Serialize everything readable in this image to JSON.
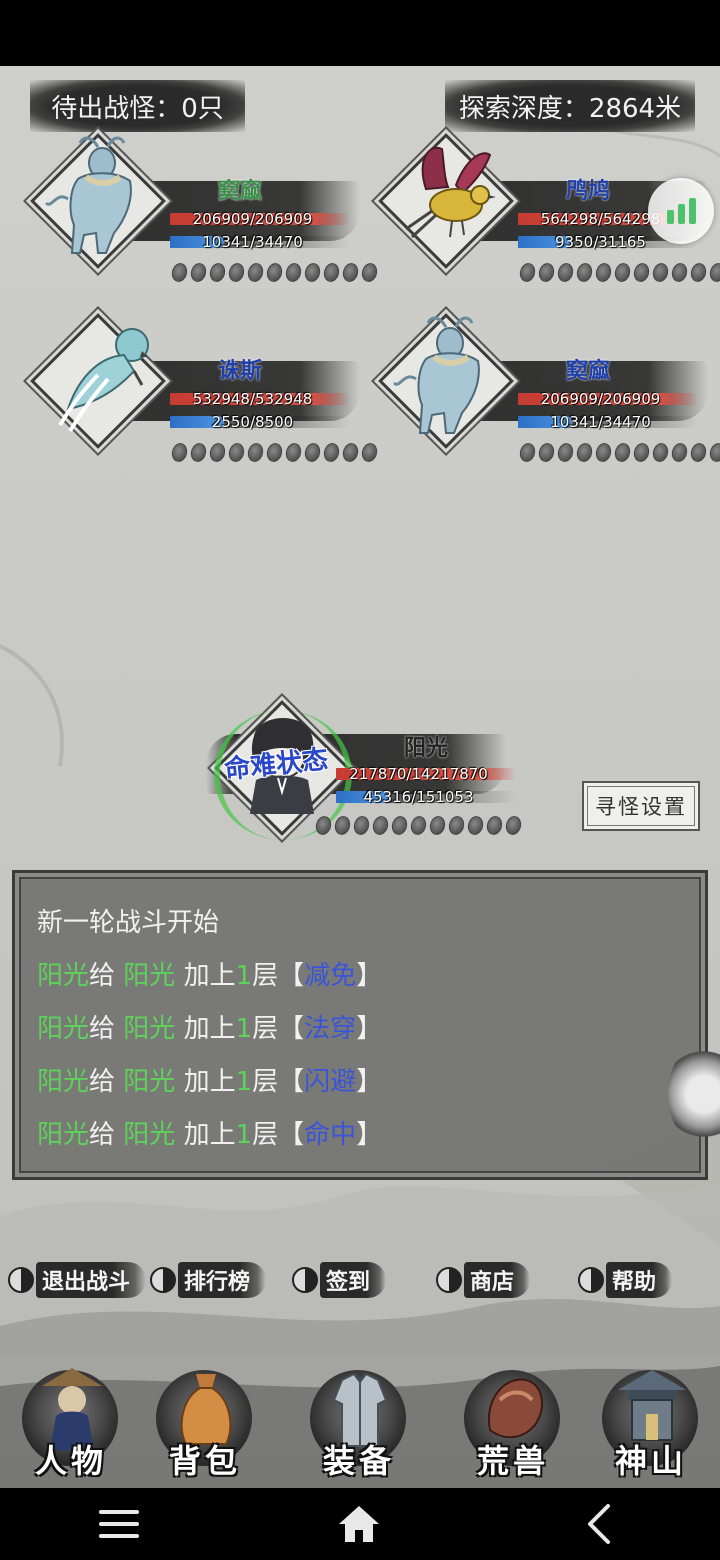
{
  "hud": {
    "waiting_monsters": "待出战怪：0只",
    "explore_depth": "探索深度：2864米"
  },
  "monsters": [
    {
      "name": "窫窳",
      "name_color": "green",
      "hp": "206909/206909",
      "hp_ratio": 1.0,
      "mp": "10341/34470",
      "mp_ratio": 0.3,
      "seeds": 11,
      "icon": "qilin-beast-portrait"
    },
    {
      "name": "鸤鸠",
      "name_color": "blue",
      "hp": "564298/564298",
      "hp_ratio": 1.0,
      "mp": "9350/31165",
      "mp_ratio": 0.3,
      "seeds": 11,
      "icon": "golden-bird-portrait"
    },
    {
      "name": "诛斯",
      "name_color": "blue",
      "hp": "532948/532948",
      "hp_ratio": 1.0,
      "mp": "2550/8500",
      "mp_ratio": 0.3,
      "seeds": 11,
      "icon": "blue-bird-portrait"
    },
    {
      "name": "窫窳",
      "name_color": "blue",
      "hp": "206909/206909",
      "hp_ratio": 1.0,
      "mp": "10341/34470",
      "mp_ratio": 0.3,
      "seeds": 11,
      "icon": "qilin-beast-portrait"
    }
  ],
  "hero": {
    "name": "阳光",
    "status": "命难状态",
    "hp": "217870/14217870",
    "mp": "45316/151053",
    "mp_ratio": 0.3,
    "seeds": 11
  },
  "find_monster_button": "寻怪设置",
  "battle_log": [
    {
      "text": "新一轮战斗开始"
    },
    {
      "src": "阳光",
      "verb": "给",
      "target": "阳光",
      "pre": "加上",
      "num": "1",
      "unit": "层",
      "lb": "【",
      "buff": "减免",
      "rb": "】"
    },
    {
      "src": "阳光",
      "verb": "给",
      "target": "阳光",
      "pre": "加上",
      "num": "1",
      "unit": "层",
      "lb": "【",
      "buff": "法穿",
      "rb": "】"
    },
    {
      "src": "阳光",
      "verb": "给",
      "target": "阳光",
      "pre": "加上",
      "num": "1",
      "unit": "层",
      "lb": "【",
      "buff": "闪避",
      "rb": "】"
    },
    {
      "src": "阳光",
      "verb": "给",
      "target": "阳光",
      "pre": "加上",
      "num": "1",
      "unit": "层",
      "lb": "【",
      "buff": "命中",
      "rb": "】"
    }
  ],
  "actions": [
    "退出战斗",
    "排行榜",
    "签到",
    "商店",
    "帮助"
  ],
  "nav": [
    "人物",
    "背包",
    "装备",
    "荒兽",
    "神山"
  ],
  "colors": {
    "accent_green": "#5ed25a",
    "buff_blue": "#3b55d8",
    "hp_red": "#c73c32",
    "mp_blue": "#2c6fc5"
  }
}
